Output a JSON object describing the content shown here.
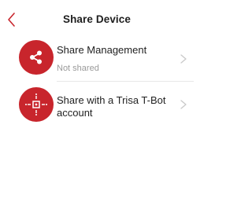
{
  "header": {
    "title": "Share Device",
    "back_icon": "chevron-left-icon"
  },
  "options": [
    {
      "label": "Share Management",
      "sublabel": "Not shared",
      "icon": "share-icon",
      "trailing_icon": "chevron-right-icon"
    },
    {
      "label": "Share with a Trisa T-Bot account",
      "icon": "device-share-icon",
      "trailing_icon": "chevron-right-icon"
    }
  ],
  "colors": {
    "accent": "#c8252c",
    "title_text": "#1e1e1e",
    "body_text": "#222222",
    "secondary_text": "#9a9a9a",
    "chevron": "#c9c9c9",
    "divider": "#e8e8e8"
  }
}
